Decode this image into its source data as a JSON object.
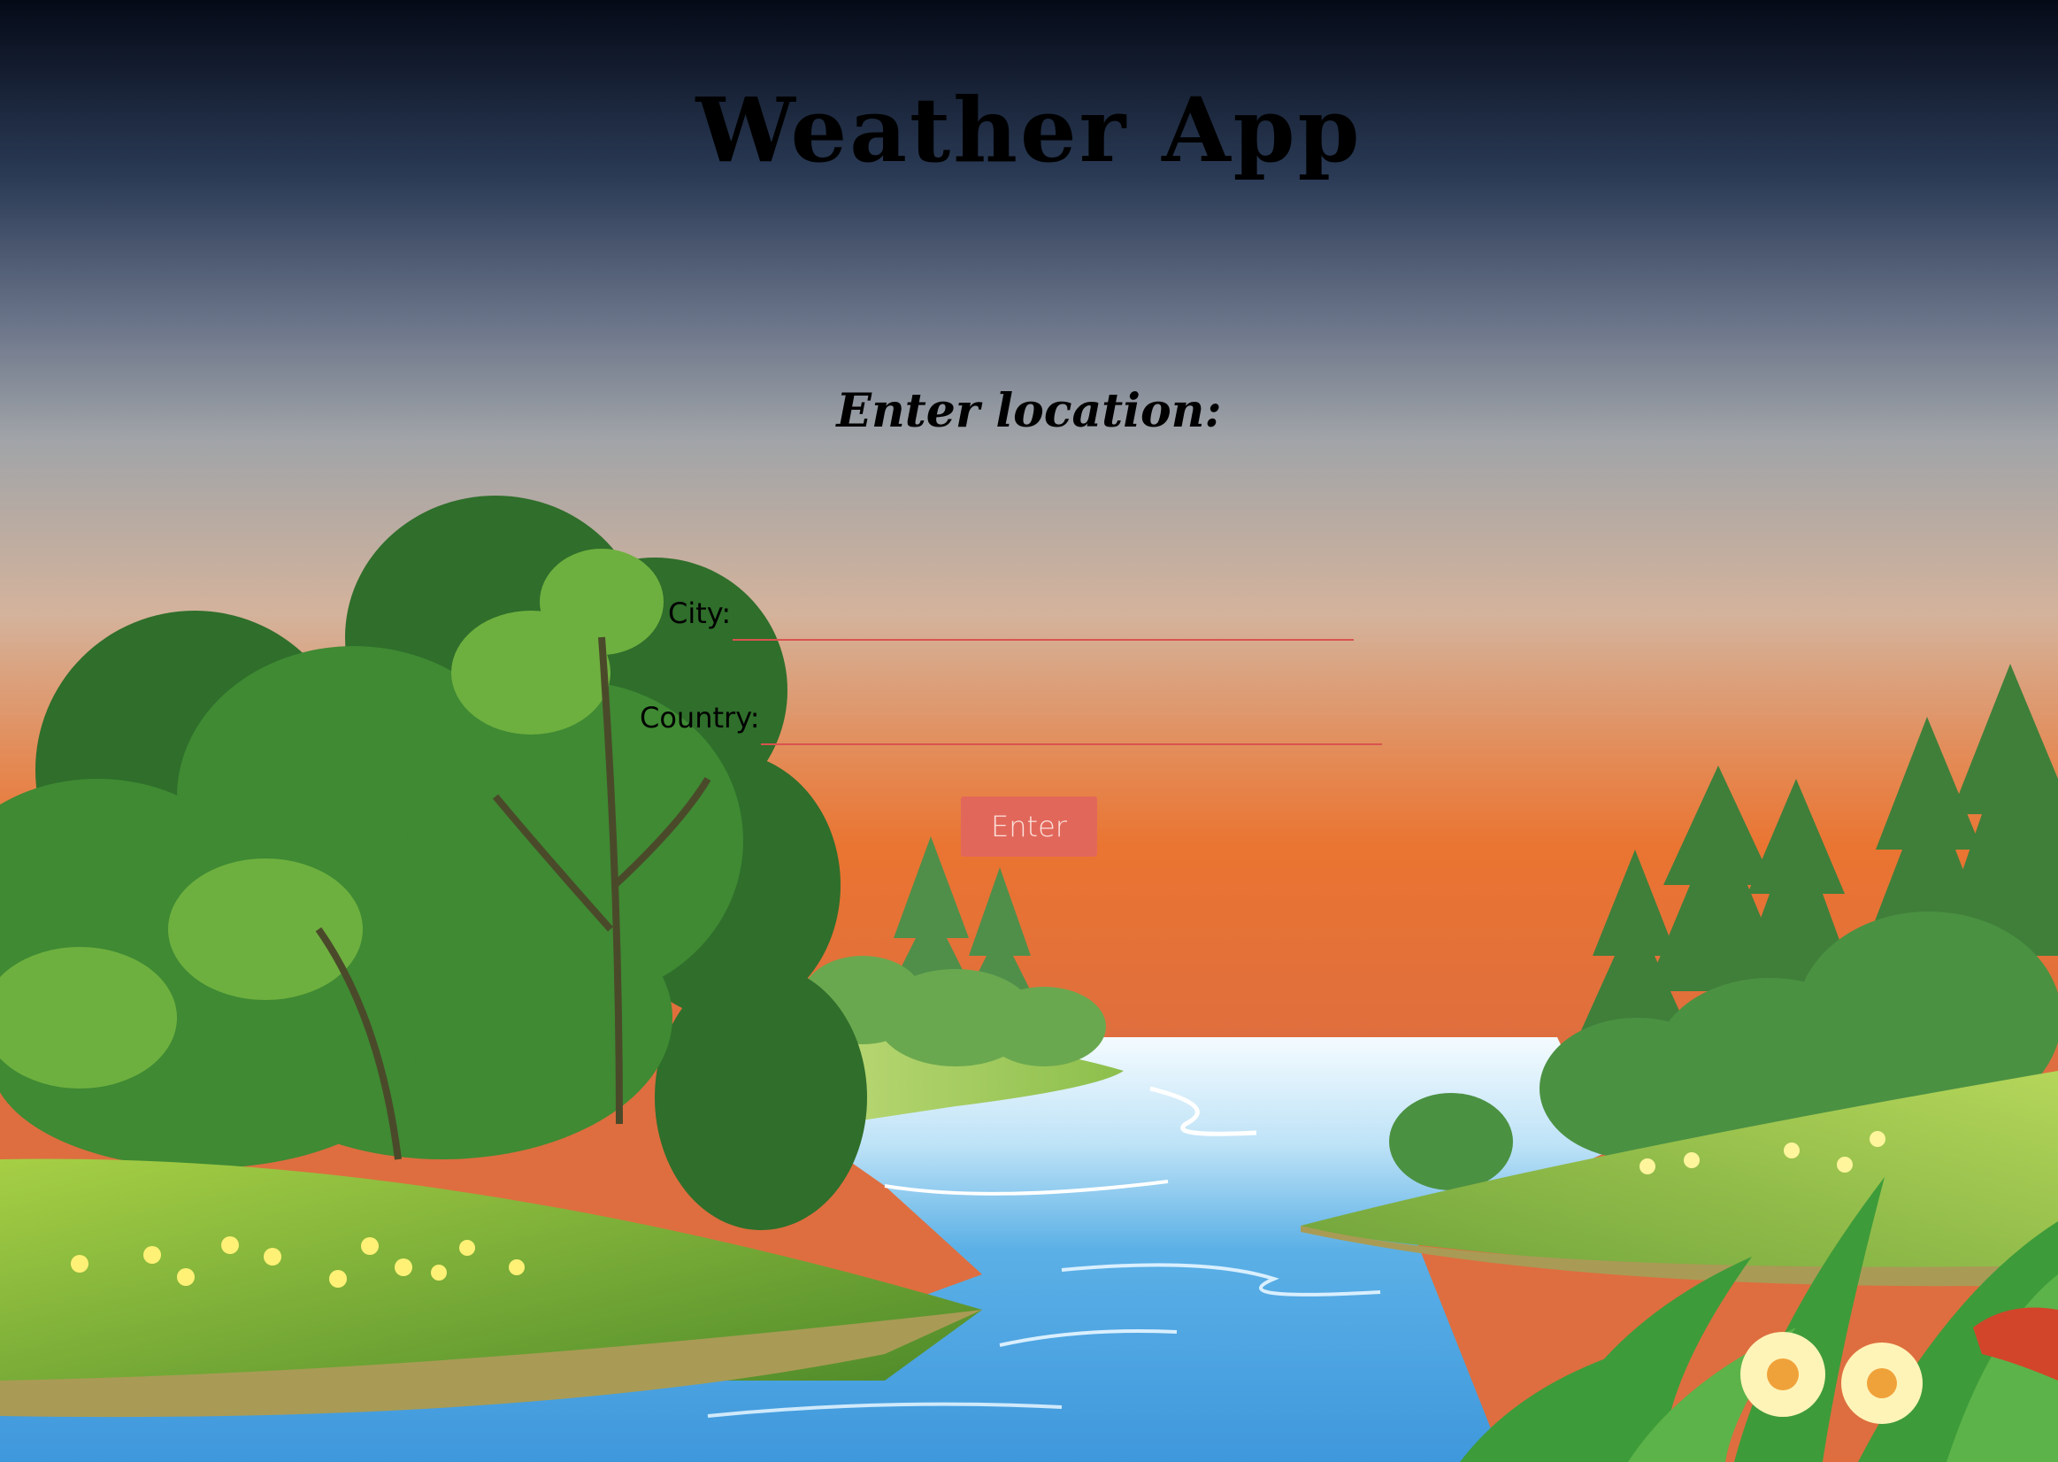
{
  "app": {
    "title": "Weather App",
    "subtitle": "Enter location:"
  },
  "form": {
    "city_label": "City:",
    "city_value": "",
    "country_label": "Country:",
    "country_value": "",
    "enter_label": "Enter"
  },
  "colors": {
    "sky_top": "#060c19",
    "sky_mid": "#a0a4a8",
    "sky_low": "#ea7431",
    "button": "#e2675b",
    "input_underline": "#d9534f",
    "river": "#4aa3e0",
    "grass": "#7cb342",
    "tree": "#2e7d32"
  },
  "background": {
    "description_icon": "landscape-river-forest-sunset"
  }
}
